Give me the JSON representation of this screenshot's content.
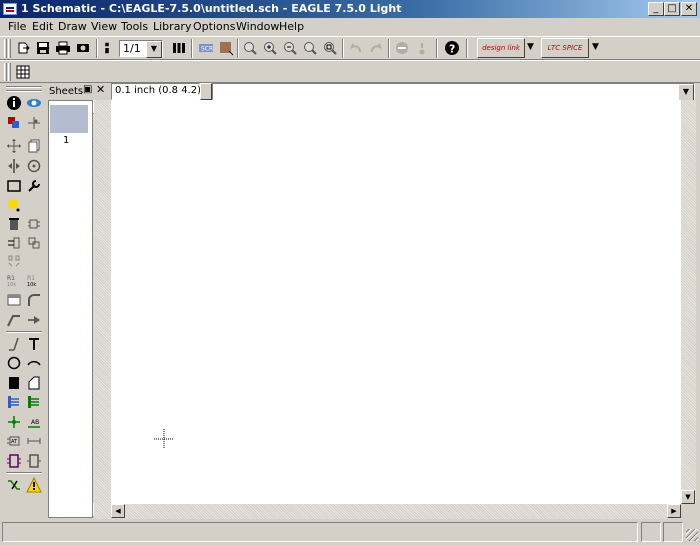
{
  "window": {
    "title": "1 Schematic - C:\\EAGLE-7.5.0\\untitled.sch - EAGLE 7.5.0 Light",
    "minimize": "_",
    "maximize": "□",
    "close": "✕"
  },
  "menu": [
    "File",
    "Edit",
    "Draw",
    "View",
    "Tools",
    "Library",
    "Options",
    "Window",
    "Help"
  ],
  "toolbar": {
    "sheet_select_value": "1/1",
    "design_link_label": "design link",
    "ltspice_label": "LTC SPICE"
  },
  "command_bar": {
    "grid_readout": "0.1 inch (0.8 4.2)",
    "command_value": ""
  },
  "sheets": {
    "header": "Sheets",
    "items": [
      {
        "label": "1"
      }
    ]
  },
  "icons": {
    "colors": {
      "accent_red": "#c00000",
      "accent_blue": "#0a246a",
      "accent_green": "#008000",
      "warn_yellow": "#ffd800"
    }
  }
}
